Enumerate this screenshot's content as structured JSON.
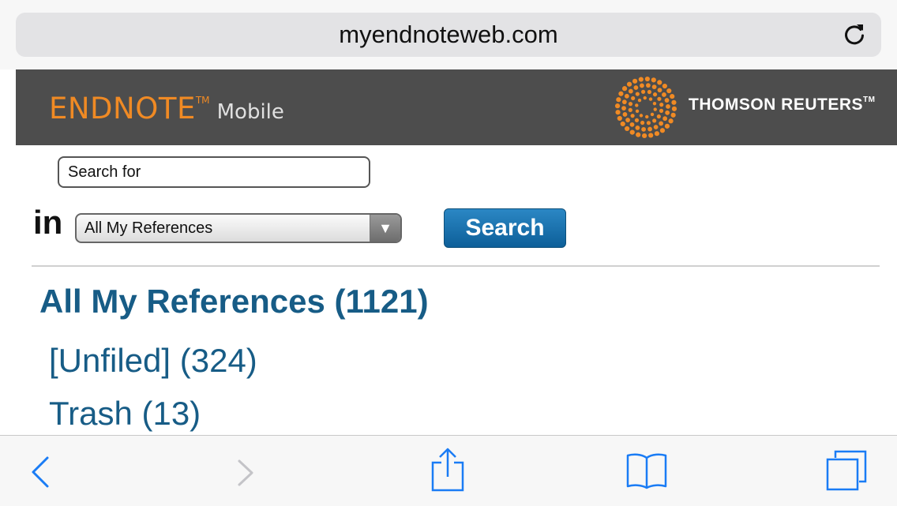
{
  "browser": {
    "url": "myendnoteweb.com"
  },
  "banner": {
    "brand_main": "ENDNOTE",
    "brand_tm": "TM",
    "brand_sub": "Mobile",
    "partner": "THOMSON REUTERS",
    "partner_tm": "TM"
  },
  "search": {
    "placeholder": "Search for",
    "in_label": "in",
    "scope_selected": "All My References",
    "button_label": "Search"
  },
  "groups": {
    "title": "All My References (1121)",
    "items": [
      {
        "label": "[Unfiled] (324)"
      },
      {
        "label": "Trash (13)"
      }
    ]
  },
  "toolbar": {
    "icons": [
      "back-icon",
      "forward-icon",
      "share-icon",
      "bookmarks-icon",
      "tabs-icon"
    ]
  },
  "colors": {
    "accent_orange": "#f08a24",
    "link_blue": "#175c86",
    "ios_blue": "#1a7cf5",
    "banner_gray": "#4d4d4d"
  }
}
